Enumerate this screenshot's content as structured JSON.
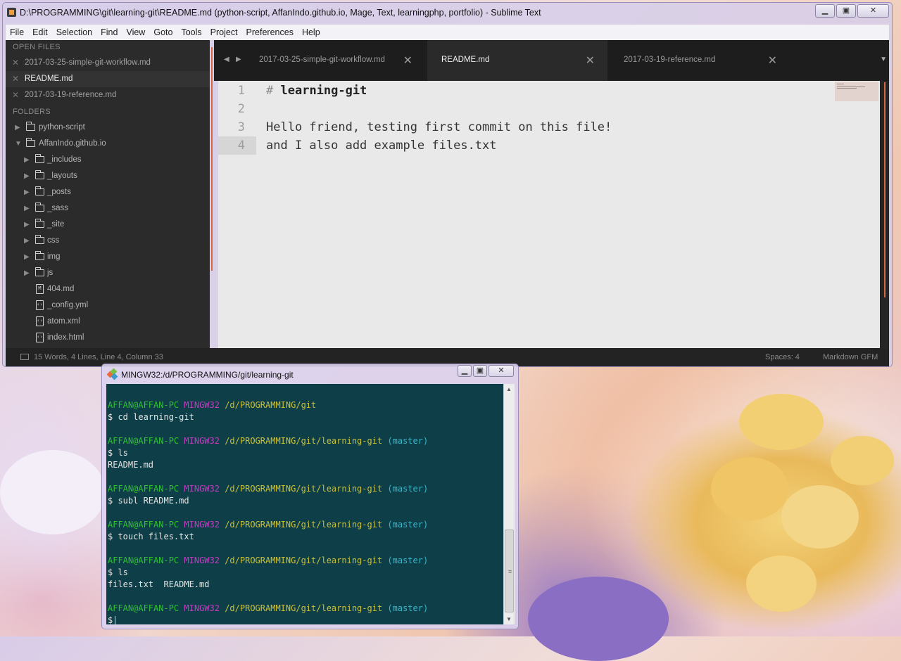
{
  "sublime": {
    "title": "D:\\PROGRAMMING\\git\\learning-git\\README.md (python-script, AffanIndo.github.io, Mage, Text, learningphp, portfolio) - Sublime Text",
    "menu": [
      "File",
      "Edit",
      "Selection",
      "Find",
      "View",
      "Goto",
      "Tools",
      "Project",
      "Preferences",
      "Help"
    ],
    "sidebar": {
      "open_files_header": "OPEN FILES",
      "open_files": [
        "2017-03-25-simple-git-workflow.md",
        "README.md",
        "2017-03-19-reference.md"
      ],
      "folders_header": "FOLDERS",
      "folders": {
        "python_script": "python-script",
        "affan": "AffanIndo.github.io",
        "includes": "_includes",
        "layouts": "_layouts",
        "posts": "_posts",
        "sass": "_sass",
        "site": "_site",
        "css": "css",
        "img": "img",
        "js": "js",
        "f404": "404.md",
        "config": "_config.yml",
        "atom": "atom.xml",
        "index": "index.html"
      }
    },
    "tabs": [
      "2017-03-25-simple-git-workflow.md",
      "README.md",
      "2017-03-19-reference.md"
    ],
    "active_tab_index": 1,
    "editor": {
      "line_numbers": [
        "1",
        "2",
        "3",
        "4"
      ],
      "hash": "#",
      "heading": "learning-git",
      "line3": "Hello friend, testing first commit on this file!",
      "line4": "and I also add example files.txt"
    },
    "status": {
      "left": "15 Words, 4 Lines, Line 4, Column 33",
      "spaces": "Spaces: 4",
      "syntax": "Markdown GFM"
    }
  },
  "terminal": {
    "title": "MINGW32:/d/PROGRAMMING/git/learning-git",
    "user": "AFFAN@AFFAN-PC",
    "env": "MINGW32",
    "path_git": "/d/PROGRAMMING/git",
    "path_repo": "/d/PROGRAMMING/git/learning-git",
    "branch": "(master)",
    "cmd1": "$ cd learning-git",
    "cmd2": "$ ls",
    "out2": "README.md",
    "cmd3": "$ subl README.md",
    "cmd4": "$ touch files.txt",
    "cmd5": "$ ls",
    "out5": "files.txt  README.md",
    "prompt": "$"
  },
  "colors": {
    "accent": "#d4693d",
    "prompt_user": "#2fc12f",
    "prompt_env": "#c13dc1",
    "prompt_path": "#c8c03a",
    "prompt_branch": "#3cb4c8"
  }
}
